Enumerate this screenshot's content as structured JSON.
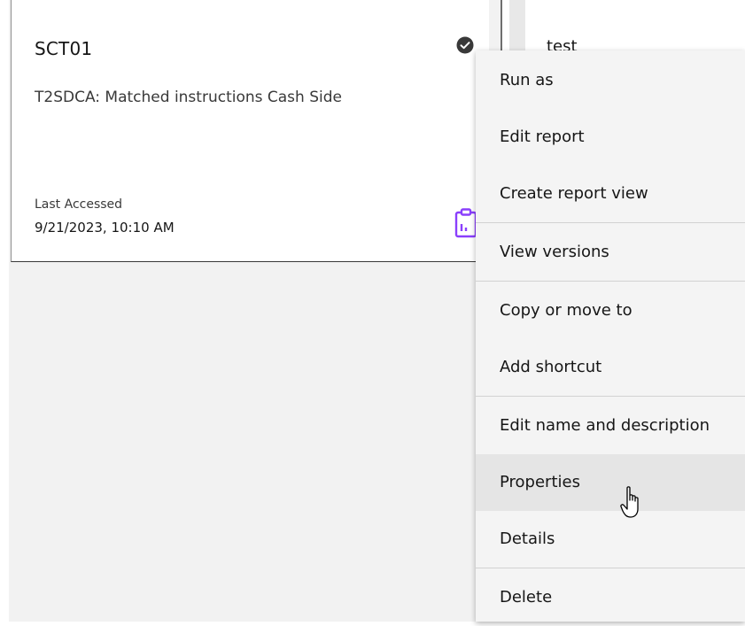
{
  "card": {
    "title": "SCT01",
    "description": "T2SDCA: Matched instructions Cash Side",
    "meta_label": "Last Accessed",
    "meta_value": "9/21/2023, 10:10 AM",
    "status_icon": "checkmark-filled-icon",
    "type_icon": "report-icon",
    "type_icon_color": "#8a3ffc"
  },
  "second_card": {
    "title": "test"
  },
  "menu": {
    "items": [
      {
        "label": "Run as"
      },
      {
        "label": "Edit report"
      },
      {
        "label": "Create report view"
      },
      {
        "label": "View versions"
      },
      {
        "label": "Copy or move to"
      },
      {
        "label": "Add shortcut"
      },
      {
        "label": "Edit name and description"
      },
      {
        "label": "Properties",
        "hovered": true
      },
      {
        "label": "Details"
      },
      {
        "label": "Delete"
      }
    ]
  },
  "cursor": {
    "icon": "hand-pointer-icon"
  }
}
